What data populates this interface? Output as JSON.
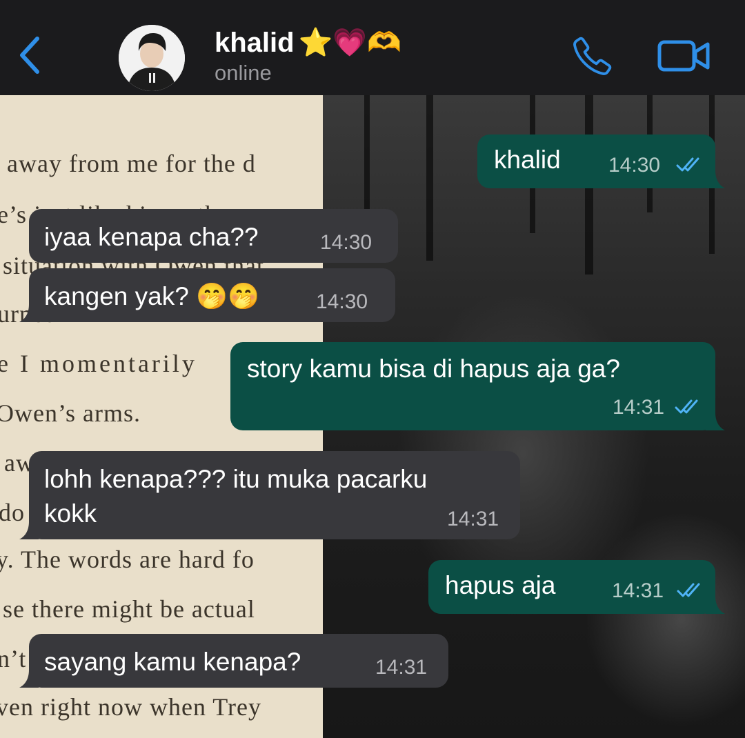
{
  "header": {
    "back_icon": "chevron-left-icon",
    "contact_name": "khalid",
    "name_emojis": "⭐💗🫶",
    "status": "online",
    "call_icon": "phone-icon",
    "video_icon": "video-camera-icon",
    "accent_color": "#2f8fe8"
  },
  "wallpaper": {
    "book_lines": [
      "away from me for the d",
      "e’s just like his mother",
      "situation with Owen that",
      "urned",
      "e I momentarily",
      "Owen’s arms.",
      "aw",
      "do",
      "y. The words are hard fo",
      "se there might be actual",
      "n’t",
      "ven right now when Trey"
    ]
  },
  "messages": [
    {
      "direction": "out",
      "text": "khalid",
      "time": "14:30",
      "read": true
    },
    {
      "direction": "in",
      "text": "iyaa kenapa cha??",
      "time": "14:30"
    },
    {
      "direction": "in",
      "text": "kangen yak? 🤭🤭",
      "time": "14:30"
    },
    {
      "direction": "out",
      "text": "story kamu bisa di hapus aja ga?",
      "time": "14:31",
      "read": true
    },
    {
      "direction": "in",
      "text_line1": "lohh kenapa??? itu muka pacarku",
      "text_line2": "kokk",
      "time": "14:31"
    },
    {
      "direction": "out",
      "text": "hapus aja",
      "time": "14:31",
      "read": true
    },
    {
      "direction": "in",
      "text": "sayang kamu kenapa?",
      "time": "14:31"
    }
  ],
  "colors": {
    "incoming_bubble": "#38383c",
    "outgoing_bubble": "#0b4f45",
    "read_ticks": "#4fb3f6"
  }
}
